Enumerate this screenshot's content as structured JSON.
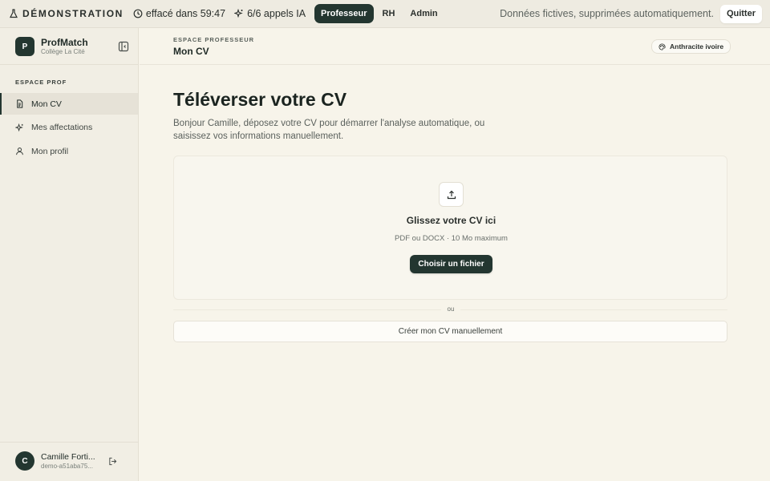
{
  "banner": {
    "demo_label": "DÉMONSTRATION",
    "timer_text": "effacé dans 59:47",
    "ai_calls_text": "6/6 appels IA",
    "roles": [
      {
        "label": "Professeur",
        "active": true
      },
      {
        "label": "RH",
        "active": false
      },
      {
        "label": "Admin",
        "active": false
      }
    ],
    "notice": "Données fictives, supprimées automatiquement.",
    "quit_label": "Quitter"
  },
  "sidebar": {
    "logo_letter": "P",
    "app_name": "ProfMatch",
    "school": "Collège La Cité",
    "section_label": "ESPACE PROF",
    "items": [
      {
        "label": "Mon CV",
        "icon": "document-icon",
        "active": true
      },
      {
        "label": "Mes affectations",
        "icon": "sparkles-icon",
        "active": false
      },
      {
        "label": "Mon profil",
        "icon": "user-icon",
        "active": false
      }
    ],
    "user": {
      "avatar_letter": "C",
      "name": "Camille Forti...",
      "subtitle": "demo-a51aba75..."
    }
  },
  "header": {
    "breadcrumb": "ESPACE PROFESSEUR",
    "title": "Mon CV",
    "theme_label": "Anthracite ivoire"
  },
  "main": {
    "title": "Téléverser votre CV",
    "intro": "Bonjour Camille, déposez votre CV pour démarrer l'analyse automatique, ou saisissez vos informations manuellement.",
    "dropzone": {
      "title": "Glissez votre CV ici",
      "subtitle": "PDF ou DOCX · 10 Mo maximum",
      "button": "Choisir un fichier"
    },
    "separator": "ou",
    "manual_button": "Créer mon CV manuellement"
  },
  "colors": {
    "accent": "#233630",
    "background": "#f7f4ea",
    "sidebar": "#f1eee4"
  }
}
